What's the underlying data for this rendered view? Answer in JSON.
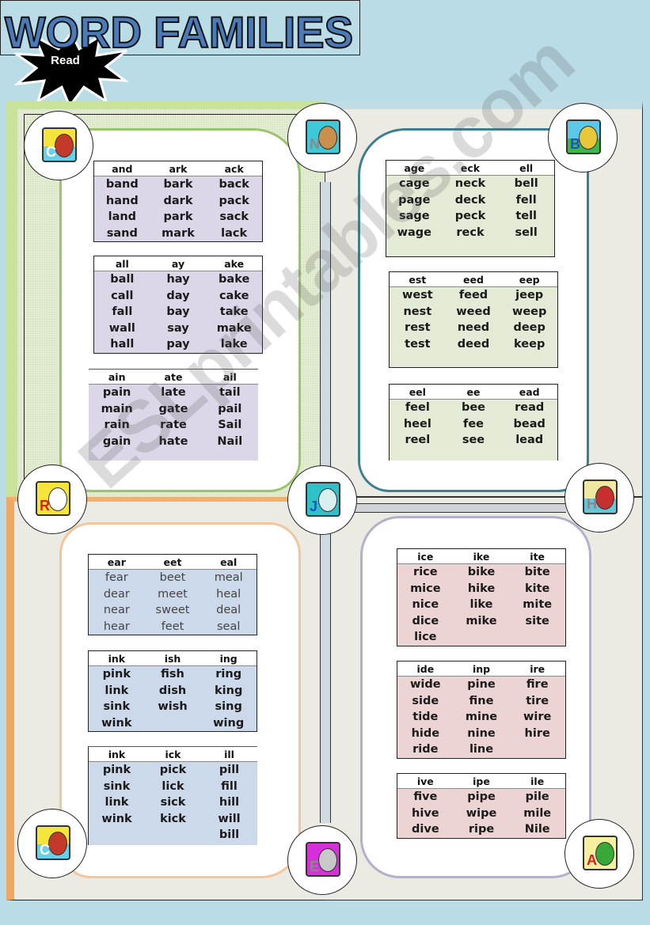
{
  "header": {
    "burst_label": "Read",
    "title": "WORD FAMILIES"
  },
  "colors": {
    "background": "#b9dce7",
    "title_fill": "#4a7ab8",
    "q1_border": "#9bc56c",
    "q2_border": "#3e7f8e",
    "q3_border": "#f4c59c",
    "q4_border": "#b4b0cc",
    "table_lavender": "#dcd7e8",
    "table_green": "#e3ead6",
    "table_blue": "#ccd9ea",
    "table_pink": "#ecd3d4"
  },
  "icons": [
    {
      "name": "cat-canoe-c-icon",
      "letter": "C"
    },
    {
      "name": "bird-nest-n-icon",
      "letter": "N"
    },
    {
      "name": "bee-baseball-b-icon",
      "letter": "B"
    },
    {
      "name": "rabbit-r-icon",
      "letter": "R"
    },
    {
      "name": "jellyfish-j-icon",
      "letter": "J"
    },
    {
      "name": "hippo-hockey-h-icon",
      "letter": "H"
    },
    {
      "name": "cat-canoe-c-icon",
      "letter": "C"
    },
    {
      "name": "elephant-e-icon",
      "letter": "E"
    },
    {
      "name": "alligator-a-icon",
      "letter": "A"
    }
  ],
  "tables": {
    "t1": {
      "headers": [
        "and",
        "ark",
        "ack"
      ],
      "rows": [
        [
          "band",
          "bark",
          "back"
        ],
        [
          "hand",
          "dark",
          "pack"
        ],
        [
          "land",
          "park",
          "sack"
        ],
        [
          "sand",
          "mark",
          "lack"
        ]
      ]
    },
    "t2": {
      "headers": [
        "all",
        "ay",
        "ake"
      ],
      "rows": [
        [
          "ball",
          "hay",
          "bake"
        ],
        [
          "call",
          "day",
          "cake"
        ],
        [
          "fall",
          "bay",
          "take"
        ],
        [
          "wall",
          "say",
          "make"
        ],
        [
          "hall",
          "pay",
          "lake"
        ]
      ]
    },
    "t3": {
      "headers": [
        "ain",
        "ate",
        "ail"
      ],
      "rows": [
        [
          "pain",
          "late",
          "tail"
        ],
        [
          "main",
          "gate",
          "pail"
        ],
        [
          "rain",
          "rate",
          "Sail"
        ],
        [
          "gain",
          "hate",
          "Nail"
        ]
      ]
    },
    "t4": {
      "headers": [
        "age",
        "eck",
        "ell"
      ],
      "rows": [
        [
          "cage",
          "neck",
          "bell"
        ],
        [
          "page",
          "deck",
          "fell"
        ],
        [
          "sage",
          "peck",
          "tell"
        ],
        [
          "wage",
          "reck",
          "sell"
        ]
      ]
    },
    "t5": {
      "headers": [
        "est",
        "eed",
        "eep"
      ],
      "rows": [
        [
          "west",
          "feed",
          "jeep"
        ],
        [
          "nest",
          "weed",
          "weep"
        ],
        [
          "rest",
          "need",
          "deep"
        ],
        [
          "test",
          "deed",
          "keep"
        ]
      ]
    },
    "t6": {
      "headers": [
        "eel",
        "ee",
        "ead"
      ],
      "rows": [
        [
          "feel",
          "bee",
          "read"
        ],
        [
          "heel",
          "fee",
          "bead"
        ],
        [
          "reel",
          "see",
          "lead"
        ]
      ]
    },
    "t7": {
      "headers": [
        "ear",
        "eet",
        "eal"
      ],
      "rows": [
        [
          "fear",
          "beet",
          "meal"
        ],
        [
          "dear",
          "meet",
          "heal"
        ],
        [
          "near",
          "sweet",
          "deal"
        ],
        [
          "hear",
          "feet",
          "seal"
        ]
      ]
    },
    "t8": {
      "headers": [
        "ink",
        "ish",
        "ing"
      ],
      "rows": [
        [
          "pink",
          "fish",
          "ring"
        ],
        [
          "link",
          "dish",
          "king"
        ],
        [
          "sink",
          "wish",
          "sing"
        ],
        [
          "wink",
          "",
          "wing"
        ]
      ]
    },
    "t9": {
      "headers": [
        "ink",
        "ick",
        "ill"
      ],
      "rows": [
        [
          "pink",
          "pick",
          "pill"
        ],
        [
          "sink",
          "lick",
          "fill"
        ],
        [
          "link",
          "sick",
          "hill"
        ],
        [
          "wink",
          "kick",
          "will"
        ],
        [
          "",
          "",
          "bill"
        ]
      ]
    },
    "t10": {
      "headers": [
        "ice",
        "ike",
        "ite"
      ],
      "rows": [
        [
          "rice",
          "bike",
          "bite"
        ],
        [
          "mice",
          "hike",
          "kite"
        ],
        [
          "nice",
          "like",
          "mite"
        ],
        [
          "dice",
          "mike",
          "site"
        ],
        [
          "lice",
          "",
          ""
        ]
      ]
    },
    "t11": {
      "headers": [
        "ide",
        "inp",
        "ire"
      ],
      "rows": [
        [
          "wide",
          "pine",
          "fire"
        ],
        [
          "side",
          "fine",
          "tire"
        ],
        [
          "tide",
          "mine",
          "wire"
        ],
        [
          "hide",
          "nine",
          "hire"
        ],
        [
          "ride",
          "line",
          ""
        ]
      ]
    },
    "t12": {
      "headers": [
        "ive",
        "ipe",
        "ile"
      ],
      "rows": [
        [
          "five",
          "pipe",
          "pile"
        ],
        [
          "hive",
          "wipe",
          "mile"
        ],
        [
          "dive",
          "ripe",
          "Nile"
        ]
      ]
    }
  },
  "watermark": "ESLprintables.com"
}
